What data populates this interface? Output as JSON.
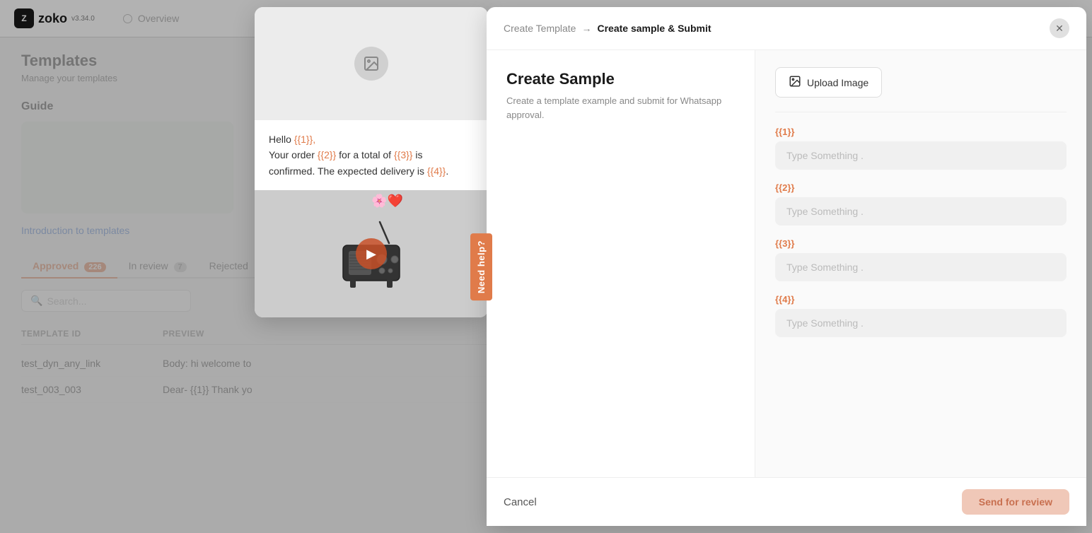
{
  "app": {
    "name": "zoko",
    "version": "v3.34.0"
  },
  "background": {
    "section_title": "Templates",
    "section_sub": "Manage your templates",
    "guide_title": "Guide",
    "guide_link": "Introduction to templates",
    "tabs": [
      {
        "label": "Approved",
        "badge": "226",
        "active": true
      },
      {
        "label": "In review",
        "badge": "7",
        "active": false
      },
      {
        "label": "Rejected",
        "badge": "",
        "active": false
      }
    ],
    "search_placeholder": "Search...",
    "table_headers": [
      "TEMPLATE ID",
      "PREVIEW"
    ],
    "table_rows": [
      {
        "id": "test_dyn_any_link",
        "preview": "Body: hi welcome to"
      },
      {
        "id": "test_003_003",
        "preview": "Dear- {{1}} Thank yo"
      }
    ]
  },
  "left_modal": {
    "preview_text_line1_before": "Hello ",
    "preview_text_line1_var": "{{1}},",
    "preview_text_line2_before": "Your order ",
    "preview_text_line2_var1": "{{2}}",
    "preview_text_line2_mid": " for a total of ",
    "preview_text_line2_var2": "{{3}}",
    "preview_text_line2_end": " is",
    "preview_text_line3_before": "confirmed. The expected delivery is ",
    "preview_text_line3_var": "{{4}}",
    "preview_text_line3_end": "."
  },
  "breadcrumb": {
    "parent": "Create Template",
    "separator": "→",
    "current": "Create sample & Submit"
  },
  "right_modal": {
    "title": "Create Sample",
    "description": "Create a template example and submit for Whatsapp approval.",
    "upload_image_label": "Upload Image",
    "variables": [
      {
        "label": "{{1}}",
        "placeholder": "Type Something ."
      },
      {
        "label": "{{2}}",
        "placeholder": "Type Something ."
      },
      {
        "label": "{{3}}",
        "placeholder": "Type Something ."
      },
      {
        "label": "{{4}}",
        "placeholder": "Type Something ."
      }
    ],
    "cancel_label": "Cancel",
    "send_review_label": "Send for review"
  },
  "need_help": {
    "label": "Need help?"
  }
}
